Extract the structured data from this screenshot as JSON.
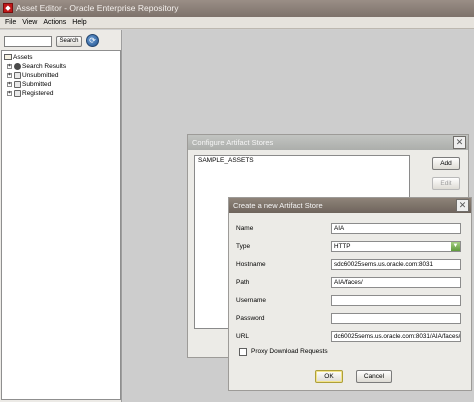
{
  "window": {
    "title": "Asset Editor - Oracle Enterprise Repository"
  },
  "menu": [
    "File",
    "View",
    "Actions",
    "Help"
  ],
  "search": {
    "value": "",
    "button_label": "Search"
  },
  "tree": {
    "root": "Assets",
    "children": [
      "Search Results",
      "Unsubmitted",
      "Submitted",
      "Registered"
    ]
  },
  "configure_dialog": {
    "title": "Configure Artifact Stores",
    "stores": [
      "SAMPLE_ASSETS"
    ],
    "add_label": "Add",
    "edit_label": "Edit"
  },
  "create_dialog": {
    "title": "Create a new Artifact Store",
    "fields": {
      "name": {
        "label": "Name",
        "value": "AIA"
      },
      "type": {
        "label": "Type",
        "value": "HTTP"
      },
      "hostname": {
        "label": "Hostname",
        "value": "sdc60025sems.us.oracle.com:8031"
      },
      "path": {
        "label": "Path",
        "value": "AIA/faces/"
      },
      "username": {
        "label": "Username",
        "value": ""
      },
      "password": {
        "label": "Password",
        "value": ""
      },
      "url": {
        "label": "URL",
        "value": "dc60025sems.us.oracle.com:8031/AIA/faces/"
      }
    },
    "proxy_label": "Proxy Download Requests",
    "proxy_checked": false,
    "ok_label": "OK",
    "cancel_label": "Cancel"
  },
  "colors": {
    "title_active": "#7d726b",
    "title_inactive": "#b5b7b4",
    "select_arrow": "#6fa848"
  }
}
